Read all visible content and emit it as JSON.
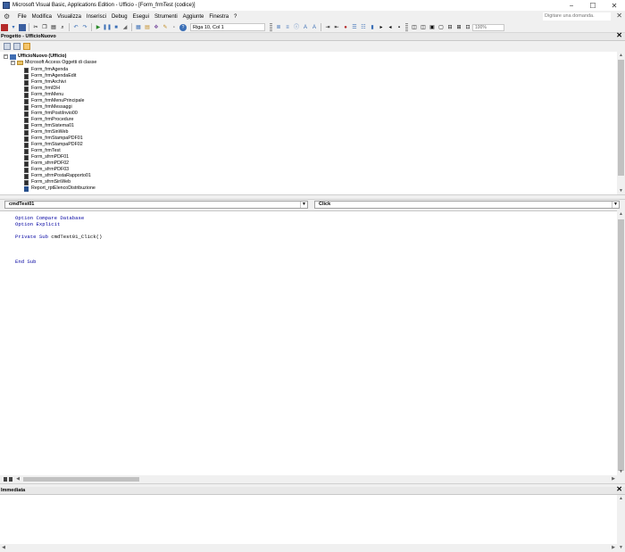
{
  "window": {
    "title": "Microsoft Visual Basic, Applications Edition - Ufficio - [Form_frmTest (codice)]",
    "min_icon": "−",
    "max_icon": "☐",
    "close_icon": "✕"
  },
  "menu": {
    "items": [
      "File",
      "Modifica",
      "Visualizza",
      "Inserisci",
      "Debug",
      "Esegui",
      "Strumenti",
      "Aggiunte",
      "Finestra",
      "?"
    ],
    "ask_placeholder": "Digitare una domanda.",
    "close_icon": "✕"
  },
  "toolbar": {
    "position_label": "Riga 10, Col 1",
    "zoom_label": "100%",
    "icons": [
      "access-icon",
      "insert-icon",
      "save-icon",
      "cut-icon",
      "copy-icon",
      "paste-icon",
      "find-icon",
      "undo-icon",
      "redo-icon",
      "run-icon",
      "break-icon",
      "reset-icon",
      "design-mode-icon",
      "project-explorer-icon",
      "properties-icon",
      "object-browser-icon",
      "toolbox-icon",
      "help-icon"
    ]
  },
  "project_panel": {
    "title": "Progetto - UfficioNuovo",
    "close_icon": "✕",
    "tree": {
      "root": "UfficioNuovo (Ufficio)",
      "folder": "Microsoft Access Oggetti di classe",
      "items": [
        {
          "label": "Form_frmAgenda",
          "kind": "form"
        },
        {
          "label": "Form_frmAgendaEdit",
          "kind": "form"
        },
        {
          "label": "Form_frmArchivi",
          "kind": "form"
        },
        {
          "label": "Form_frmIDH",
          "kind": "form"
        },
        {
          "label": "Form_frmMenu",
          "kind": "form"
        },
        {
          "label": "Form_frmMenuPrincipale",
          "kind": "form"
        },
        {
          "label": "Form_frmMessaggi",
          "kind": "form"
        },
        {
          "label": "Form_frmPostiInvio00",
          "kind": "form"
        },
        {
          "label": "Form_frmProcedure",
          "kind": "form"
        },
        {
          "label": "Form_frmSistema01",
          "kind": "form"
        },
        {
          "label": "Form_frmSinWeb",
          "kind": "form"
        },
        {
          "label": "Form_frmStampaPDF01",
          "kind": "form"
        },
        {
          "label": "Form_frmStampaPDF02",
          "kind": "form"
        },
        {
          "label": "Form_frmTest",
          "kind": "form"
        },
        {
          "label": "Form_sfrmPDF01",
          "kind": "form"
        },
        {
          "label": "Form_sfrmPDF02",
          "kind": "form"
        },
        {
          "label": "Form_sfrmPDF03",
          "kind": "form"
        },
        {
          "label": "Form_sfrmPostaRapporto01",
          "kind": "form"
        },
        {
          "label": "Form_sfrmSinWeb",
          "kind": "form"
        },
        {
          "label": "Report_rptElencoDistribuzione",
          "kind": "report"
        }
      ]
    }
  },
  "code_window": {
    "object_combo": "cmdTest01",
    "procedure_combo": "Click",
    "lines": [
      {
        "text": "Option Compare Database",
        "kind": "kw"
      },
      {
        "text": "Option Explicit",
        "kind": "kw"
      },
      {
        "text": "",
        "kind": "plain"
      },
      {
        "text": "Private Sub cmdTest01_Click()",
        "kind": "mixed"
      },
      {
        "text": "",
        "kind": "plain"
      },
      {
        "text": "",
        "kind": "plain"
      },
      {
        "text": "",
        "kind": "plain"
      },
      {
        "text": "End Sub",
        "kind": "kw"
      }
    ]
  },
  "immediate_panel": {
    "title": "Immediata",
    "close_icon": "✕"
  },
  "colors": {
    "keyword": "#0000a0",
    "chrome": "#f0f0f0",
    "editor_bg": "#ffffff"
  }
}
